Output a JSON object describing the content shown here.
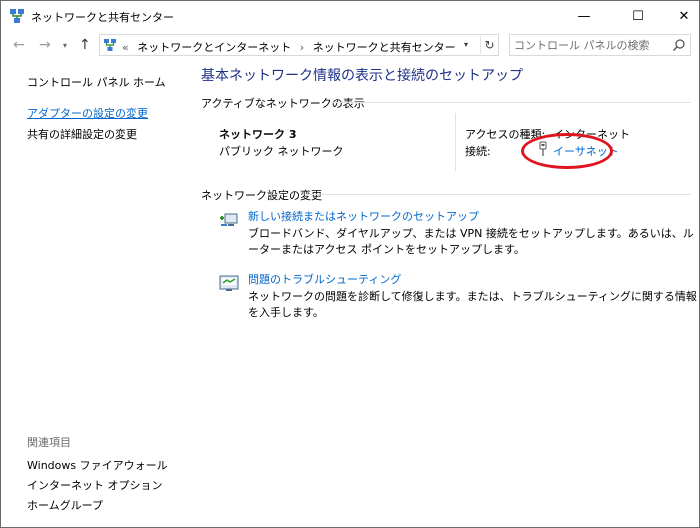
{
  "window": {
    "title": "ネットワークと共有センター",
    "controls": {
      "minimize": "—",
      "maximize": "☐",
      "close": "✕"
    }
  },
  "navigation": {
    "back": "←",
    "forward": "→",
    "recent": "▾",
    "up": "↑",
    "breadcrumb_prefix": "«",
    "breadcrumbs": [
      "ネットワークとインターネット",
      "ネットワークと共有センター"
    ],
    "separator": "›",
    "dropdown": "▾",
    "refresh": "↻",
    "search_placeholder": "コントロール パネルの検索"
  },
  "sidebar": {
    "home": "コントロール パネル ホーム",
    "links": [
      "アダプターの設定の変更",
      "共有の詳細設定の変更"
    ],
    "related_heading": "関連項目",
    "related": [
      "Windows ファイアウォール",
      "インターネット オプション",
      "ホームグループ"
    ]
  },
  "main": {
    "title": "基本ネットワーク情報の表示と接続のセットアップ",
    "active_heading": "アクティブなネットワークの表示",
    "network": {
      "name": "ネットワーク 3",
      "category": "パブリック ネットワーク",
      "access_label": "アクセスの種類:",
      "access_value": "インターネット",
      "connection_label": "接続:",
      "connection_value": "イーサネット"
    },
    "settings_heading": "ネットワーク設定の変更",
    "tasks": [
      {
        "title": "新しい接続またはネットワークのセットアップ",
        "description": "ブロードバンド、ダイヤルアップ、または VPN 接続をセットアップします。あるいは、ルーターまたはアクセス ポイントをセットアップします。"
      },
      {
        "title": "問題のトラブルシューティング",
        "description": "ネットワークの問題を診断して修復します。または、トラブルシューティングに関する情報を入手します。"
      }
    ]
  },
  "colors": {
    "link": "#0066cc",
    "title": "#1e3287",
    "highlight": "#e0141e"
  }
}
